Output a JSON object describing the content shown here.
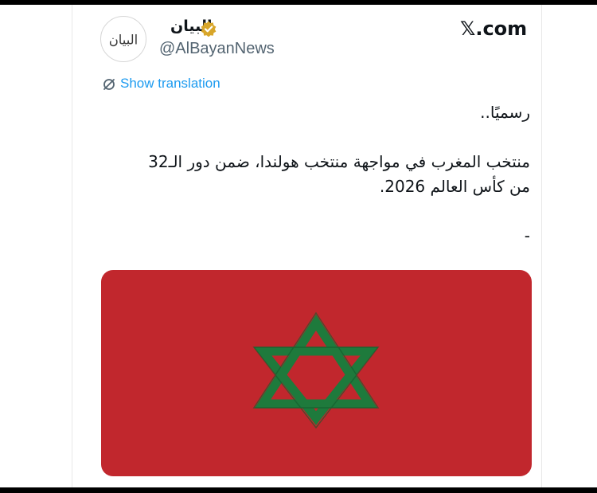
{
  "tweet": {
    "author": {
      "display_name": "البيان",
      "handle": "@AlBayanNews",
      "avatar_text": "البيان",
      "verified_icon": "verified-gold-badge-icon"
    },
    "source_label": "𝕏.com",
    "show_translation_label": "Show translation",
    "translate_icon": "translate-icon",
    "text_lines": [
      "رسميًا..",
      "منتخب المغرب في مواجهة منتخب هولندا، ضمن دور الـ32",
      "من كأس العالم 2026.",
      "-"
    ],
    "media": {
      "type": "flag-image",
      "flag_color": "#c1272d",
      "star_color": "#1e7a3c",
      "emblem_icon": "six-pointed-star-icon"
    }
  },
  "colors": {
    "link": "#1d9bf0",
    "secondary_text": "#536471",
    "verified_gold": "#d8a62a"
  }
}
